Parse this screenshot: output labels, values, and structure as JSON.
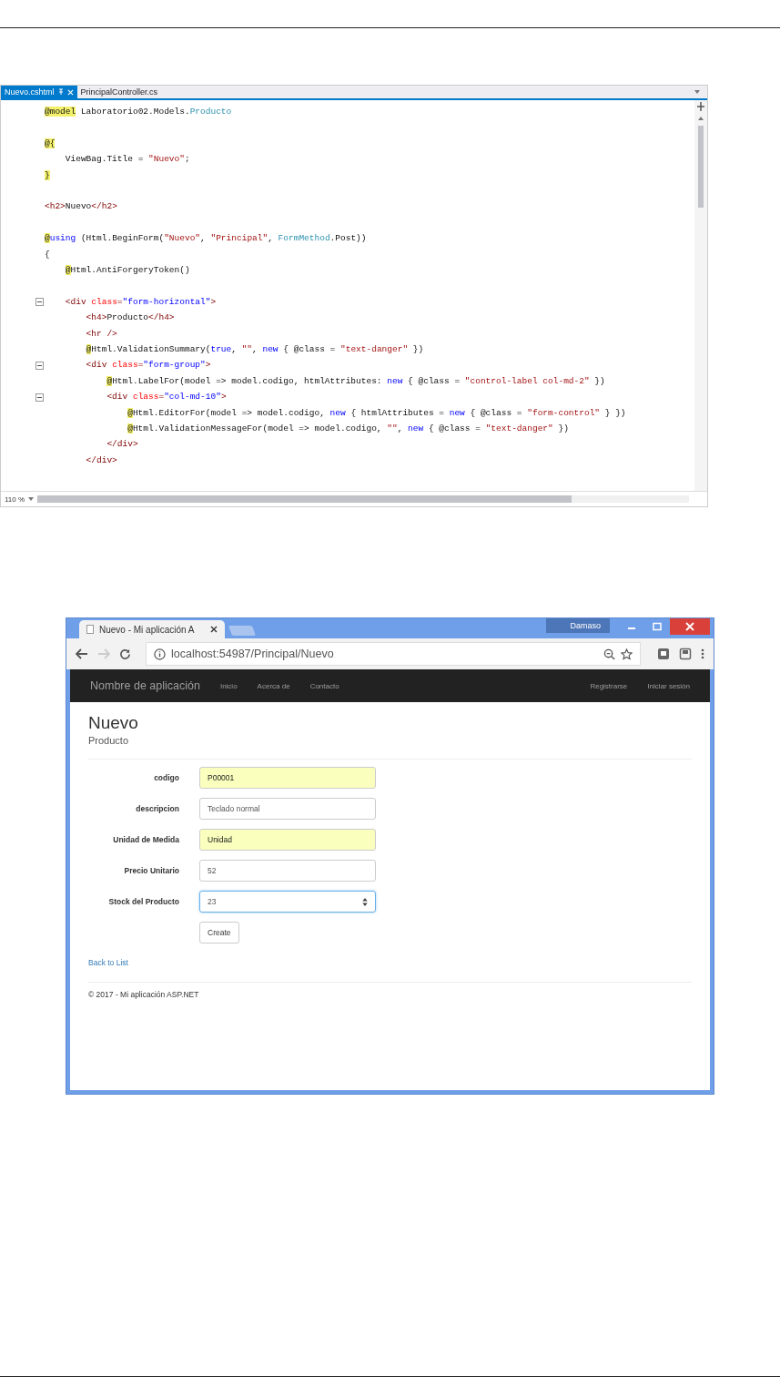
{
  "editor": {
    "tabs": [
      {
        "label": "Nuevo.cshtml",
        "selected": true
      },
      {
        "label": "PrincipalController.cs",
        "selected": false
      }
    ],
    "lines": [
      {
        "tokens": [
          {
            "kind": "razor",
            "text": "@model"
          },
          {
            "kind": "text",
            "text": " Laboratorio02.Models."
          },
          {
            "kind": "type",
            "text": "Producto"
          }
        ]
      },
      {
        "space_before": true,
        "tokens": [
          {
            "kind": "razor",
            "text": "@{"
          }
        ]
      },
      {
        "tokens": [
          {
            "kind": "text",
            "text": "    ViewBag.Title = "
          },
          {
            "kind": "string",
            "text": "\"Nuevo\""
          },
          {
            "kind": "text",
            "text": ";"
          }
        ]
      },
      {
        "tokens": [
          {
            "kind": "razor",
            "text": "}"
          }
        ]
      },
      {
        "space_before": true,
        "tokens": [
          {
            "kind": "tag",
            "text": "<h2>"
          },
          {
            "kind": "text",
            "text": "Nuevo"
          },
          {
            "kind": "tag",
            "text": "</h2>"
          }
        ]
      },
      {
        "space_before": true,
        "tokens": [
          {
            "kind": "razor",
            "text": "@"
          },
          {
            "kind": "keyword",
            "text": "using"
          },
          {
            "kind": "text",
            "text": " (Html.BeginForm("
          },
          {
            "kind": "string",
            "text": "\"Nuevo\""
          },
          {
            "kind": "text",
            "text": ", "
          },
          {
            "kind": "string",
            "text": "\"Principal\""
          },
          {
            "kind": "text",
            "text": ", "
          },
          {
            "kind": "type",
            "text": "FormMethod"
          },
          {
            "kind": "text",
            "text": ".Post))"
          }
        ]
      },
      {
        "tokens": [
          {
            "kind": "text",
            "text": "{"
          }
        ]
      },
      {
        "tokens": [
          {
            "kind": "razor",
            "text": "    @"
          },
          {
            "kind": "text",
            "text": "Html.AntiForgeryToken()"
          }
        ]
      },
      {
        "space_before": true,
        "fold": true,
        "tokens": [
          {
            "kind": "tag",
            "text": "    <div "
          },
          {
            "kind": "attr",
            "text": "class"
          },
          {
            "kind": "tag",
            "text": "="
          },
          {
            "kind": "value",
            "text": "\"form-horizontal\""
          },
          {
            "kind": "tag",
            "text": ">"
          }
        ]
      },
      {
        "tokens": [
          {
            "kind": "tag",
            "text": "        <h4>"
          },
          {
            "kind": "text",
            "text": "Producto"
          },
          {
            "kind": "tag",
            "text": "</h4>"
          }
        ]
      },
      {
        "tokens": [
          {
            "kind": "tag",
            "text": "        <hr />"
          }
        ]
      },
      {
        "tokens": [
          {
            "kind": "razor",
            "text": "        @"
          },
          {
            "kind": "text",
            "text": "Html.ValidationSummary("
          },
          {
            "kind": "keyword",
            "text": "true"
          },
          {
            "kind": "text",
            "text": ", "
          },
          {
            "kind": "string",
            "text": "\"\""
          },
          {
            "kind": "text",
            "text": ", "
          },
          {
            "kind": "keyword",
            "text": "new"
          },
          {
            "kind": "text",
            "text": " { @class = "
          },
          {
            "kind": "string",
            "text": "\"text-danger\""
          },
          {
            "kind": "text",
            "text": " })"
          }
        ]
      },
      {
        "fold": true,
        "tokens": [
          {
            "kind": "tag",
            "text": "        <div "
          },
          {
            "kind": "attr",
            "text": "class"
          },
          {
            "kind": "tag",
            "text": "="
          },
          {
            "kind": "value",
            "text": "\"form-group\""
          },
          {
            "kind": "tag",
            "text": ">"
          }
        ]
      },
      {
        "tokens": [
          {
            "kind": "razor",
            "text": "            @"
          },
          {
            "kind": "text",
            "text": "Html.LabelFor(model => model.codigo, htmlAttributes: "
          },
          {
            "kind": "keyword",
            "text": "new"
          },
          {
            "kind": "text",
            "text": " { @class = "
          },
          {
            "kind": "string",
            "text": "\"control-label col-md-2\""
          },
          {
            "kind": "text",
            "text": " })"
          }
        ]
      },
      {
        "fold": true,
        "tokens": [
          {
            "kind": "tag",
            "text": "            <div "
          },
          {
            "kind": "attr",
            "text": "class"
          },
          {
            "kind": "tag",
            "text": "="
          },
          {
            "kind": "value",
            "text": "\"col-md-10\""
          },
          {
            "kind": "tag",
            "text": ">"
          }
        ]
      },
      {
        "tokens": [
          {
            "kind": "razor",
            "text": "                @"
          },
          {
            "kind": "text",
            "text": "Html.EditorFor(model => model.codigo, "
          },
          {
            "kind": "keyword",
            "text": "new"
          },
          {
            "kind": "text",
            "text": " { htmlAttributes = "
          },
          {
            "kind": "keyword",
            "text": "new"
          },
          {
            "kind": "text",
            "text": " { @class = "
          },
          {
            "kind": "string",
            "text": "\"form-control\""
          },
          {
            "kind": "text",
            "text": " } })"
          }
        ]
      },
      {
        "tokens": [
          {
            "kind": "razor",
            "text": "                @"
          },
          {
            "kind": "text",
            "text": "Html.ValidationMessageFor(model => model.codigo, "
          },
          {
            "kind": "string",
            "text": "\"\""
          },
          {
            "kind": "text",
            "text": ", "
          },
          {
            "kind": "keyword",
            "text": "new"
          },
          {
            "kind": "text",
            "text": " { @class = "
          },
          {
            "kind": "string",
            "text": "\"text-danger\""
          },
          {
            "kind": "text",
            "text": " })"
          }
        ]
      },
      {
        "tokens": [
          {
            "kind": "tag",
            "text": "            </div>"
          }
        ]
      },
      {
        "tokens": [
          {
            "kind": "tag",
            "text": "        </div>"
          }
        ]
      }
    ],
    "zoom": "110 %"
  },
  "browser": {
    "tab_title": "Nuevo - Mi aplicación A",
    "user": "Damaso",
    "url": "localhost:54987/Principal/Nuevo",
    "brand": "Nombre de aplicación",
    "nav_left": [
      "Inicio",
      "Acerca de",
      "Contacto"
    ],
    "nav_right": [
      "Registrarse",
      "Iniciar sesión"
    ],
    "heading": "Nuevo",
    "subheading": "Producto",
    "fields": [
      {
        "label": "codigo",
        "value": "P00001",
        "autofilled": true,
        "focused": false,
        "kind": "text"
      },
      {
        "label": "descripcion",
        "value": "Teclado normal",
        "autofilled": false,
        "focused": false,
        "kind": "text"
      },
      {
        "label": "Unidad de Medida",
        "value": "Unidad",
        "autofilled": true,
        "focused": false,
        "kind": "text"
      },
      {
        "label": "Precio Unitario",
        "value": "52",
        "autofilled": false,
        "focused": false,
        "kind": "text"
      },
      {
        "label": "Stock del Producto",
        "value": "23",
        "autofilled": false,
        "focused": true,
        "kind": "number"
      }
    ],
    "submit": "Create",
    "back_link": "Back to List",
    "footer": "© 2017 - Mi aplicación ASP.NET"
  }
}
